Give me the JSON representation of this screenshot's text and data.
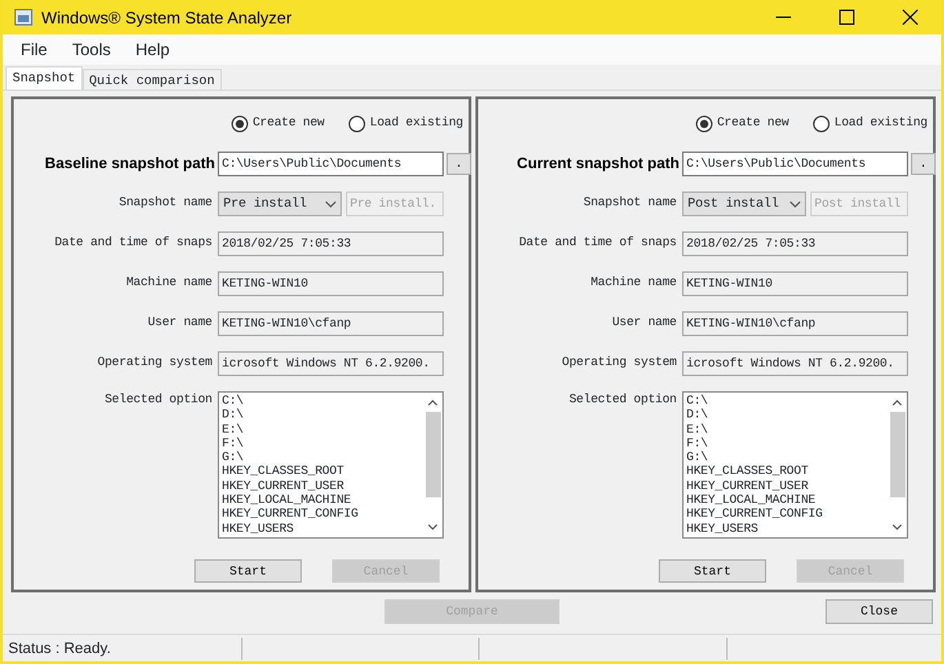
{
  "window": {
    "title": "Windows® System State Analyzer"
  },
  "menu": [
    "File",
    "Tools",
    "Help"
  ],
  "tabs": [
    {
      "label": "Snapshot",
      "selected": true
    },
    {
      "label": "Quick comparison",
      "selected": false
    }
  ],
  "panels": [
    {
      "mode_options": [
        {
          "label": "Create new",
          "selected": true
        },
        {
          "label": "Load existing",
          "selected": false
        }
      ],
      "path_label": "Baseline snapshot path",
      "path": "C:\\Users\\Public\\Documents",
      "browse_button": ".",
      "fields": [
        {
          "kind": "combo",
          "label": "Snapshot name",
          "value": "Pre install",
          "extra": "Pre install."
        },
        {
          "kind": "readonly",
          "label": "Date and time of snaps",
          "value": "2018/02/25 7:05:33"
        },
        {
          "kind": "readonly",
          "label": "Machine name",
          "value": "KETING-WIN10"
        },
        {
          "kind": "readonly",
          "label": "User name",
          "value": "KETING-WIN10\\cfanp"
        },
        {
          "kind": "readonly",
          "label": "Operating system",
          "value": "icrosoft Windows NT 6.2.9200."
        },
        {
          "kind": "list",
          "label": "Selected option",
          "items": [
            "C:\\",
            "D:\\",
            "E:\\",
            "F:\\",
            "G:\\",
            "HKEY_CLASSES_ROOT",
            "HKEY_CURRENT_USER",
            "HKEY_LOCAL_MACHINE",
            "HKEY_CURRENT_CONFIG",
            "HKEY_USERS"
          ]
        }
      ],
      "buttons": [
        {
          "label": "Start",
          "disabled": false
        },
        {
          "label": "Cancel",
          "disabled": true
        }
      ]
    },
    {
      "mode_options": [
        {
          "label": "Create new",
          "selected": true
        },
        {
          "label": "Load existing",
          "selected": false
        }
      ],
      "path_label": "Current snapshot path",
      "path": "C:\\Users\\Public\\Documents",
      "browse_button": ".",
      "fields": [
        {
          "kind": "combo",
          "label": "Snapshot name",
          "value": "Post install",
          "extra": "Post install"
        },
        {
          "kind": "readonly",
          "label": "Date and time of snaps",
          "value": "2018/02/25 7:05:33"
        },
        {
          "kind": "readonly",
          "label": "Machine name",
          "value": "KETING-WIN10"
        },
        {
          "kind": "readonly",
          "label": "User name",
          "value": "KETING-WIN10\\cfanp"
        },
        {
          "kind": "readonly",
          "label": "Operating system",
          "value": "icrosoft Windows NT 6.2.9200."
        },
        {
          "kind": "list",
          "label": "Selected option",
          "items": [
            "C:\\",
            "D:\\",
            "E:\\",
            "F:\\",
            "G:\\",
            "HKEY_CLASSES_ROOT",
            "HKEY_CURRENT_USER",
            "HKEY_LOCAL_MACHINE",
            "HKEY_CURRENT_CONFIG",
            "HKEY_USERS"
          ]
        }
      ],
      "buttons": [
        {
          "label": "Start",
          "disabled": false
        },
        {
          "label": "Cancel",
          "disabled": true
        }
      ]
    }
  ],
  "footer_buttons": [
    {
      "label": "Compare",
      "disabled": true
    },
    {
      "label": "Close",
      "disabled": false
    }
  ],
  "status_bar": [
    "Status : Ready."
  ]
}
